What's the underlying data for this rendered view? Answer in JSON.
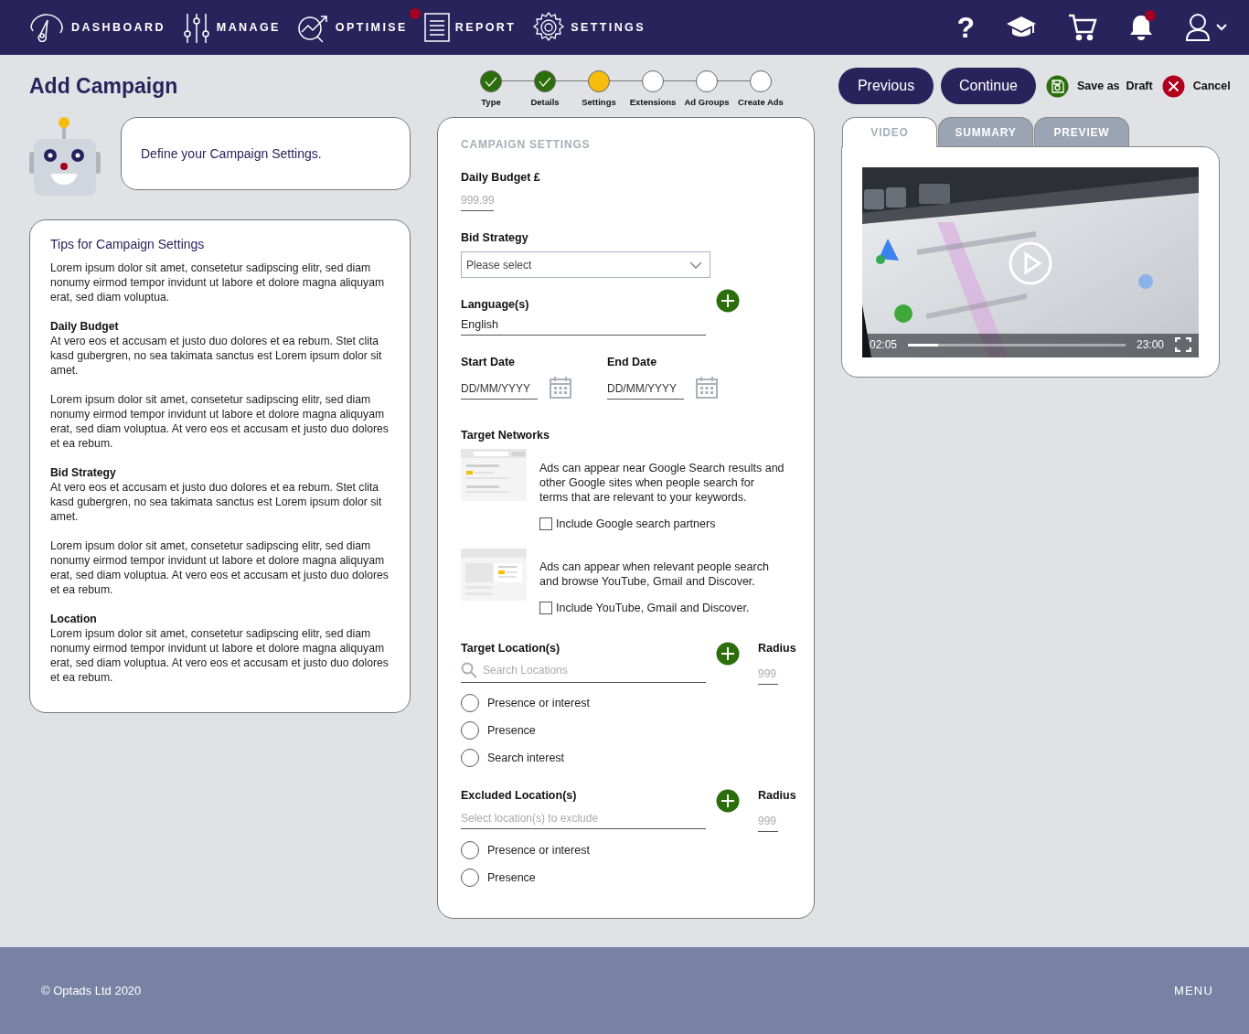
{
  "nav": {
    "items": [
      {
        "label": "DASHBOARD",
        "kind": "gauge",
        "badge": false
      },
      {
        "label": "MANAGE",
        "kind": "sliders",
        "badge": false
      },
      {
        "label": "OPTIMISE",
        "kind": "chart",
        "badge": true
      },
      {
        "label": "REPORT",
        "kind": "document",
        "badge": false
      },
      {
        "label": "SETTINGS",
        "kind": "gear",
        "badge": false
      }
    ],
    "tools": [
      {
        "kind": "help",
        "text": "?",
        "badge": false
      },
      {
        "kind": "learn",
        "badge": false
      },
      {
        "kind": "cart",
        "badge": false
      },
      {
        "kind": "bell",
        "badge": true
      },
      {
        "kind": "account",
        "badge": false
      }
    ]
  },
  "page_title": "Add Campaign",
  "assistant": {
    "message": "Define your Campaign Settings."
  },
  "tips": {
    "title": "Tips for Campaign Settings",
    "sections": [
      {
        "text": "Lorem ipsum dolor sit amet, consetetur sadipscing elitr, sed diam nonumy eirmod tempor invidunt ut labore et dolore magna aliquyam erat, sed diam voluptua."
      },
      {
        "heading": "Daily Budget",
        "text": "At vero eos et accusam et justo duo dolores et ea rebum. Stet clita kasd gubergren, no sea takimata sanctus est Lorem ipsum dolor sit amet."
      },
      {
        "text": "Lorem ipsum dolor sit amet, consetetur sadipscing elitr, sed diam nonumy eirmod tempor invidunt ut labore et dolore magna aliquyam erat, sed diam voluptua. At vero eos et accusam et justo duo dolores et ea rebum."
      },
      {
        "heading": "Bid Strategy",
        "text": "At vero eos et accusam et justo duo dolores et ea rebum. Stet clita kasd gubergren, no sea takimata sanctus est Lorem ipsum dolor sit amet."
      },
      {
        "text": "Lorem ipsum dolor sit amet, consetetur sadipscing elitr, sed diam nonumy eirmod tempor invidunt ut labore et dolore magna aliquyam erat, sed diam voluptua. At vero eos et accusam et justo duo dolores et ea rebum."
      },
      {
        "heading": "Location",
        "text": "Lorem ipsum dolor sit amet, consetetur sadipscing elitr, sed diam nonumy eirmod tempor invidunt ut labore et dolore magna aliquyam erat, sed diam voluptua. At vero eos et accusam et justo duo dolores et ea rebum."
      }
    ]
  },
  "stepper": {
    "steps": [
      {
        "label": "Type",
        "completed": true,
        "current": false
      },
      {
        "label": "Details",
        "completed": true,
        "current": false
      },
      {
        "label": "Settings",
        "completed": false,
        "current": true
      },
      {
        "label": "Extensions",
        "completed": false,
        "current": false
      },
      {
        "label": "Ad Groups",
        "completed": false,
        "current": false
      },
      {
        "label": "Create Ads",
        "completed": false,
        "current": false
      }
    ]
  },
  "settings": {
    "title": "CAMPAIGN SETTINGS",
    "daily_budget": {
      "label": "Daily Budget £",
      "placeholder": "999.99"
    },
    "bid_strategy": {
      "label": "Bid Strategy",
      "placeholder": "Please select"
    },
    "languages": {
      "label": "Language(s)",
      "value": "English"
    },
    "start_date": {
      "label": "Start Date",
      "placeholder": "DD/MM/YYYY"
    },
    "end_date": {
      "label": "End Date",
      "placeholder": "DD/MM/YYYY"
    },
    "target_networks": {
      "label": "Target Networks",
      "options": [
        {
          "kind": "search",
          "description": "Ads can appear near Google Search results and other Google sites when people search for terms that are relevant to your keywords.",
          "checkbox_label": "Include Google search partners",
          "checked": false
        },
        {
          "kind": "display",
          "description": "Ads can appear when relevant people search and browse YouTube, Gmail and Discover.",
          "checkbox_label": "Include YouTube, Gmail and Discover.",
          "checked": false
        }
      ]
    },
    "target_locations": {
      "label": "Target Location(s)",
      "placeholder": "Search Locations",
      "radius_label": "Radius",
      "radius_placeholder": "999",
      "options": [
        {
          "label": "Presence or interest",
          "selected": false
        },
        {
          "label": "Presence",
          "selected": false
        },
        {
          "label": "Search interest",
          "selected": false
        }
      ]
    },
    "excluded_locations": {
      "label": "Excluded Location(s)",
      "placeholder": "Select location(s) to exclude",
      "radius_label": "Radius",
      "radius_placeholder": "999",
      "options": [
        {
          "label": "Presence or interest",
          "selected": false
        },
        {
          "label": "Presence",
          "selected": false
        }
      ]
    }
  },
  "actions": {
    "previous": "Previous",
    "continue": "Continue",
    "save_draft": "Save as  Draft",
    "cancel": "Cancel"
  },
  "panel_tabs": [
    {
      "label": "VIDEO",
      "selected": true
    },
    {
      "label": "SUMMARY",
      "selected": false
    },
    {
      "label": "PREVIEW",
      "selected": false
    }
  ],
  "video": {
    "current_time": "02:05",
    "duration": "23:00",
    "level": 0.14
  },
  "footer": {
    "copyright": "© Optads Ltd 2020",
    "menu": "MENU"
  }
}
